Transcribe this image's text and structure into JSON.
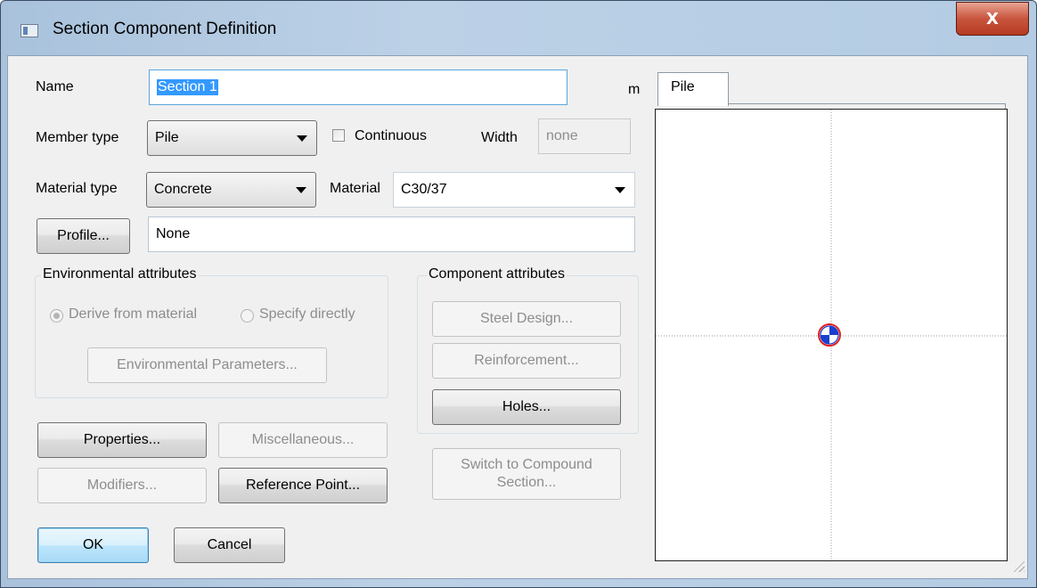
{
  "window": {
    "title": "Section Component Definition",
    "close_symbol": "X"
  },
  "form": {
    "name_label": "Name",
    "name_value": "Section 1",
    "unit": "m",
    "member_type_label": "Member type",
    "member_type_value": "Pile",
    "continuous_label": "Continuous",
    "continuous_checked": false,
    "width_label": "Width",
    "width_value": "none",
    "material_type_label": "Material type",
    "material_type_value": "Concrete",
    "material_label": "Material",
    "material_value": "C30/37",
    "profile_button": "Profile...",
    "profile_value": "None"
  },
  "environmental": {
    "title": "Environmental attributes",
    "derive_label": "Derive from material",
    "specify_label": "Specify directly",
    "selected": "derive",
    "params_button": "Environmental Parameters..."
  },
  "component": {
    "title": "Component attributes",
    "steel_button": "Steel Design...",
    "reinforcement_button": "Reinforcement...",
    "holes_button": "Holes..."
  },
  "buttons": {
    "properties": "Properties...",
    "miscellaneous": "Miscellaneous...",
    "modifiers": "Modifiers...",
    "reference_point": "Reference Point...",
    "switch_compound": "Switch to Compound Section...",
    "ok": "OK",
    "cancel": "Cancel"
  },
  "preview": {
    "tab_label": "Pile",
    "marker_colors": {
      "ring": "#e02020",
      "fill": "#1a3fd0"
    }
  }
}
